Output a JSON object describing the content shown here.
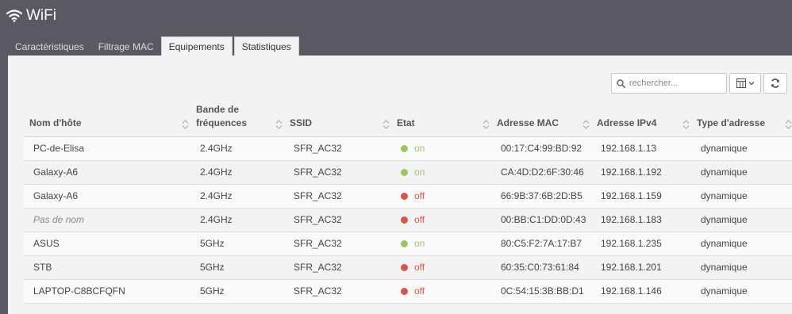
{
  "app": {
    "title": "WiFi"
  },
  "tabs": [
    {
      "label": "Caractéristiques",
      "active": false
    },
    {
      "label": "Filtrage MAC",
      "active": false
    },
    {
      "label": "Equipements",
      "active": true
    },
    {
      "label": "Statistiques",
      "active": false
    }
  ],
  "toolbar": {
    "search_placeholder": "rechercher...",
    "columns_icon": "columns-icon",
    "refresh_icon": "refresh-icon"
  },
  "colors": {
    "on": "#9cc85b",
    "off": "#d9534f"
  },
  "table": {
    "headers": [
      "Nom d'hôte",
      "Bande de fréquences",
      "SSID",
      "Etat",
      "Adresse MAC",
      "Adresse IPv4",
      "Type d'adresse"
    ],
    "rows": [
      {
        "host": "PC-de-Elisa",
        "band": "2.4GHz",
        "ssid": "SFR_AC32",
        "state": "on",
        "mac": "00:17:C4:99:BD:92",
        "ip": "192.168.1.13",
        "type": "dynamique",
        "italic": false
      },
      {
        "host": "Galaxy-A6",
        "band": "2.4GHz",
        "ssid": "SFR_AC32",
        "state": "on",
        "mac": "CA:4D:D2:6F:30:46",
        "ip": "192.168.1.192",
        "type": "dynamique",
        "italic": false
      },
      {
        "host": "Galaxy-A6",
        "band": "2.4GHz",
        "ssid": "SFR_AC32",
        "state": "off",
        "mac": "66:9B:37:6B:2D:B5",
        "ip": "192.168.1.159",
        "type": "dynamique",
        "italic": false
      },
      {
        "host": "Pas de nom",
        "band": "2.4GHz",
        "ssid": "SFR_AC32",
        "state": "off",
        "mac": "00:BB:C1:DD:0D:43",
        "ip": "192.168.1.183",
        "type": "dynamique",
        "italic": true
      },
      {
        "host": "ASUS",
        "band": "5GHz",
        "ssid": "SFR_AC32",
        "state": "on",
        "mac": "80:C5:F2:7A:17:B7",
        "ip": "192.168.1.235",
        "type": "dynamique",
        "italic": false
      },
      {
        "host": "STB",
        "band": "5GHz",
        "ssid": "SFR_AC32",
        "state": "off",
        "mac": "60:35:C0:73:61:84",
        "ip": "192.168.1.201",
        "type": "dynamique",
        "italic": false
      },
      {
        "host": "LAPTOP-C8BCFQFN",
        "band": "5GHz",
        "ssid": "SFR_AC32",
        "state": "off",
        "mac": "0C:54:15:3B:BB:D1",
        "ip": "192.168.1.146",
        "type": "dynamique",
        "italic": false
      }
    ]
  }
}
